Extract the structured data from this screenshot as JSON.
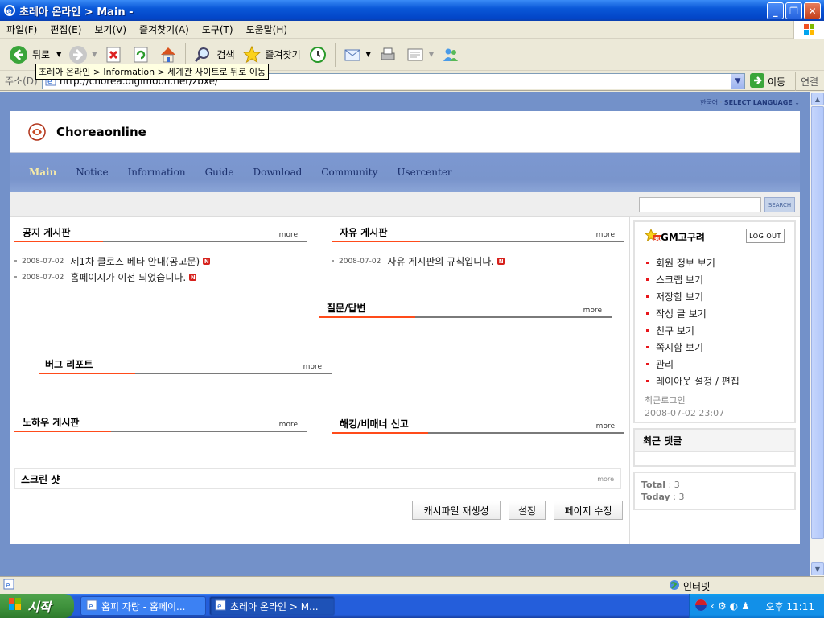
{
  "window": {
    "title": "초레아 온라인 > Main -"
  },
  "menu": [
    "파일(F)",
    "편집(E)",
    "보기(V)",
    "즐겨찾기(A)",
    "도구(T)",
    "도움말(H)"
  ],
  "toolbar": {
    "back_label": "뒤로",
    "search_label": "검색",
    "favorites_label": "즐겨찾기"
  },
  "tooltip": "초레아 온라인 > Information > 세계관 사이트로 뒤로 이동",
  "address": {
    "label": "주소(D)",
    "url": "http://chorea.digimoon.net/zbxe/",
    "go_label": "이동",
    "links_label": "연결"
  },
  "site": {
    "topbar": {
      "lang_current": "한국어",
      "lang_select": "SELECT LANGUAGE"
    },
    "name": "Choreaonline",
    "nav": [
      "Main",
      "Notice",
      "Information",
      "Guide",
      "Download",
      "Community",
      "Usercenter"
    ],
    "search_button": "SEARCH",
    "more": "more",
    "boards": {
      "notice": {
        "title": "공지 게시판",
        "posts": [
          {
            "date": "2008-07-02",
            "title": "제1차 클로즈 베타 안내(공고문)"
          },
          {
            "date": "2008-07-02",
            "title": "홈페이지가 이전 되었습니다."
          }
        ]
      },
      "free": {
        "title": "자유 게시판",
        "posts": [
          {
            "date": "2008-07-02",
            "title": "자유 게시판의 규칙입니다."
          }
        ]
      },
      "qna": {
        "title": "질문/답변"
      },
      "bug": {
        "title": "버그 리포트"
      },
      "knowhow": {
        "title": "노하우 게시판"
      },
      "hacking": {
        "title": "해킹/비매너 신고"
      },
      "screenshot": {
        "title": "스크린 샷"
      }
    },
    "user": {
      "name": "GM고구려",
      "level": "30",
      "logout": "LOG OUT",
      "menu": [
        "회원 정보 보기",
        "스크랩 보기",
        "저장함 보기",
        "작성 글 보기",
        "친구 보기",
        "쪽지함 보기",
        "관리",
        "레이아웃 설정 / 편집"
      ],
      "last_login_label": "최근로그인",
      "last_login": "2008-07-02 23:07"
    },
    "recent_comments": "최근 댓글",
    "counter": {
      "total_label": "Total",
      "total": "3",
      "today_label": "Today",
      "today": "3"
    },
    "buttons": {
      "cache": "캐시파일 재생성",
      "settings": "설정",
      "edit_page": "페이지 수정"
    }
  },
  "status": {
    "zone": "인터넷"
  },
  "taskbar": {
    "start": "시작",
    "tasks": [
      "홈피 자랑 - 홈페이...",
      "초레아 온라인 > M..."
    ],
    "clock": "오후 11:11"
  },
  "colors": {
    "nav_bg": "#7c98d1",
    "accent_line": "#ff4b1a",
    "new_badge": "#d6201b"
  }
}
